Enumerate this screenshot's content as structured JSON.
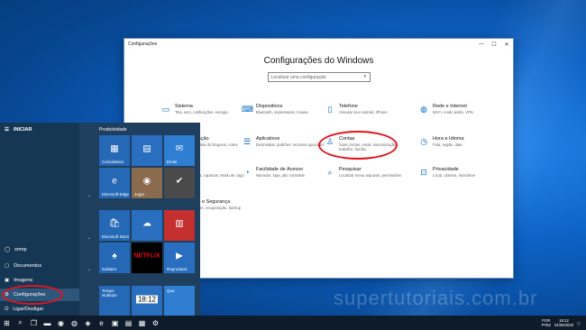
{
  "window": {
    "title": "Configurações",
    "heading": "Configurações do Windows",
    "search_placeholder": "Localizar uma configuração"
  },
  "categories": [
    {
      "name": "Sistema",
      "desc": "Tela, som, notificações, energia",
      "icon": "monitor-icon"
    },
    {
      "name": "Dispositivos",
      "desc": "Bluetooth, impressoras, mouse",
      "icon": "devices-icon"
    },
    {
      "name": "Telefone",
      "desc": "Vincular seu Android, iPhone",
      "icon": "phone-icon"
    },
    {
      "name": "Rede e Internet",
      "desc": "Wi-Fi, modo avião, VPN",
      "icon": "globe-icon"
    },
    {
      "name": "Personalização",
      "desc": "Tela de fundo, tela de bloqueio, cores",
      "icon": "brush-icon"
    },
    {
      "name": "Aplicativos",
      "desc": "Desinstalar, padrões, recursos opcionais",
      "icon": "apps-icon"
    },
    {
      "name": "Contas",
      "desc": "Suas contas, email, sincronização, trabalho, família",
      "icon": "person-icon"
    },
    {
      "name": "Hora e Idioma",
      "desc": "Fala, região, data",
      "icon": "clock-language-icon"
    },
    {
      "name": "Jogos",
      "desc": "Xbox Game Bar, capturas, Modo de Jogo",
      "icon": "gamepad-icon"
    },
    {
      "name": "Facilidade de Acesso",
      "desc": "Narrador, lupa, alto contraste",
      "icon": "accessibility-icon"
    },
    {
      "name": "Pesquisar",
      "desc": "Localizar meus arquivos, permissões",
      "icon": "search-icon"
    },
    {
      "name": "Privacidade",
      "desc": "Local, câmera, microfone",
      "icon": "lock-icon"
    },
    {
      "name": "Atualização e Segurança",
      "desc": "Windows Update, recuperação, backup",
      "icon": "sync-icon"
    }
  ],
  "start": {
    "header": "INICIAR",
    "group": "Produtividade",
    "rail": [
      {
        "label": "smnp",
        "icon": "user-icon"
      },
      {
        "label": "Documentos",
        "icon": "document-icon"
      },
      {
        "label": "Imagens",
        "icon": "image-icon"
      },
      {
        "label": "Configurações",
        "icon": "gear-icon"
      },
      {
        "label": "Ligar/Desligar",
        "icon": "power-icon"
      }
    ],
    "tiles": {
      "calc": "Calculadora",
      "email": "Email",
      "edge": "Microsoft Edge",
      "games": "Jogar",
      "store": "Microsoft Store",
      "solitaire": "Solitaire",
      "weather_day1": "Sex",
      "weather_day2": "Sáb",
      "weather_day3": "Qua",
      "netflix": "NETFLIX",
      "player": "Reprodutor",
      "weather_now": "Tempo Nublado"
    }
  },
  "taskbar": {
    "time": "18:12",
    "date": "01/09/2020",
    "lang": "POR",
    "kbd": "PTB2"
  },
  "watermark": "supertutoriais.com.br"
}
